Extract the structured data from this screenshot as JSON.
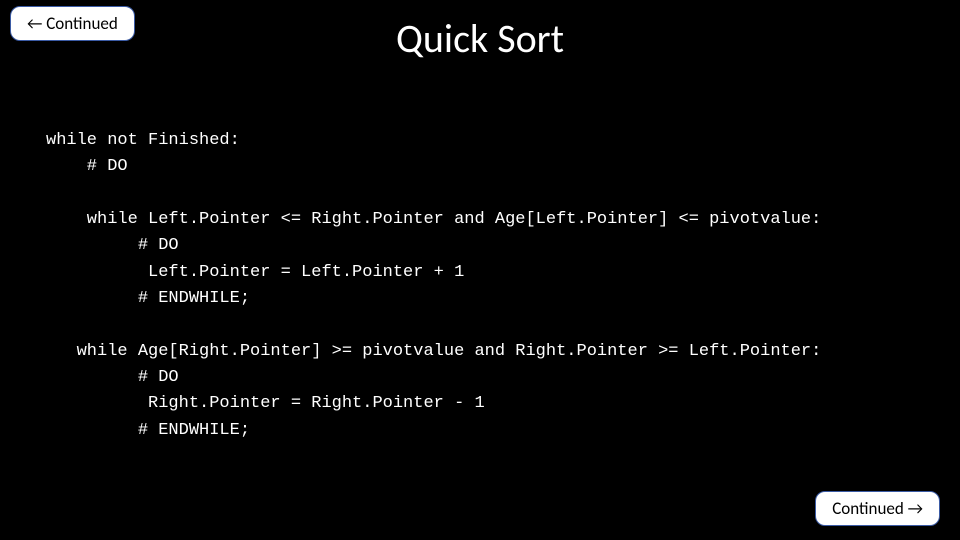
{
  "nav": {
    "prev_arrow": "←",
    "prev_label": " Continued",
    "next_label": "Continued ",
    "next_arrow": "→"
  },
  "title": "Quick Sort",
  "code": {
    "l1": "while not Finished:",
    "l2": "    # DO",
    "l3": "",
    "l4": "    while Left.Pointer <= Right.Pointer and Age[Left.Pointer] <= pivotvalue:",
    "l5": "         # DO",
    "l6": "          Left.Pointer = Left.Pointer + 1",
    "l7": "         # ENDWHILE;",
    "l8": "",
    "l9": "   while Age[Right.Pointer] >= pivotvalue and Right.Pointer >= Left.Pointer:",
    "l10": "         # DO",
    "l11": "          Right.Pointer = Right.Pointer - 1",
    "l12": "         # ENDWHILE;"
  }
}
